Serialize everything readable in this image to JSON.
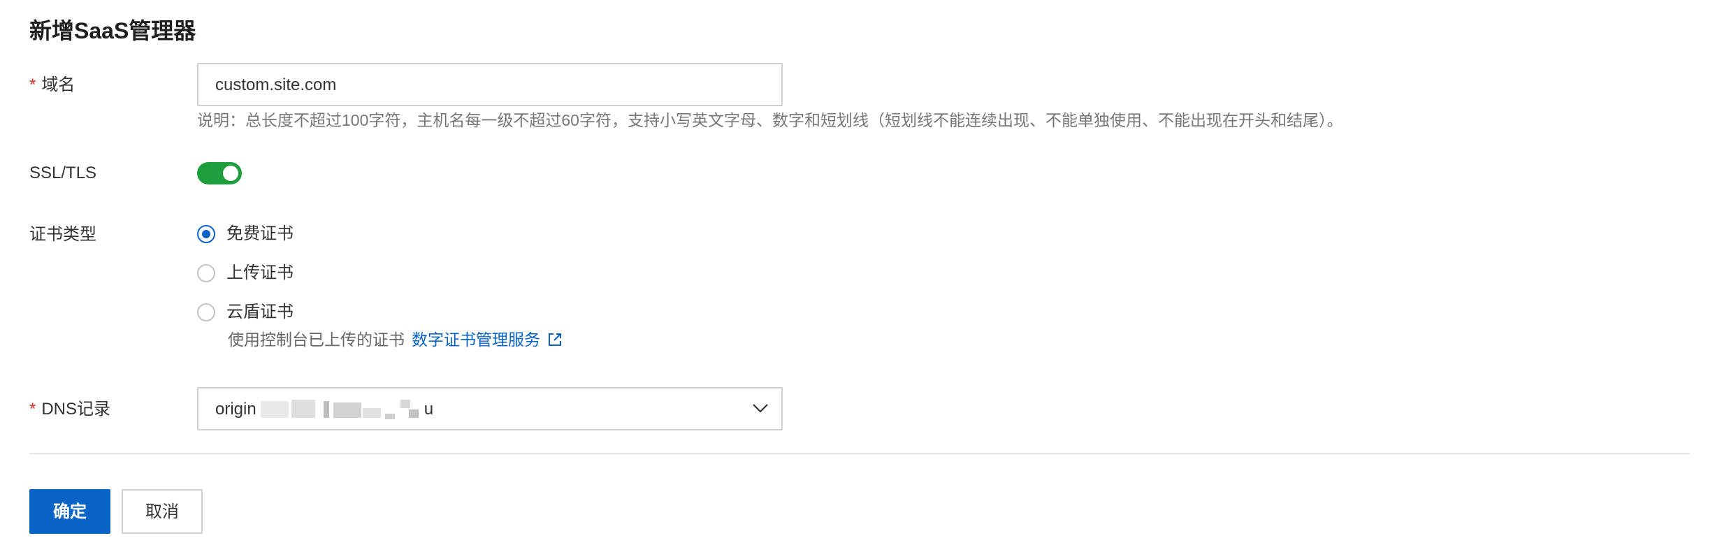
{
  "page": {
    "title": "新增SaaS管理器"
  },
  "domain_field": {
    "required_mark": "*",
    "label": "域名",
    "value": "custom.site.com",
    "hint": "说明：总长度不超过100字符，主机名每一级不超过60字符，支持小写英文字母、数字和短划线（短划线不能连续出现、不能单独使用、不能出现在开头和结尾）。"
  },
  "ssl_field": {
    "label": "SSL/TLS",
    "enabled": true
  },
  "cert_type": {
    "label": "证书类型",
    "options": [
      {
        "label": "免费证书",
        "checked": true
      },
      {
        "label": "上传证书",
        "checked": false
      },
      {
        "label": "云盾证书",
        "checked": false
      }
    ],
    "cloud_desc": "使用控制台已上传的证书",
    "cloud_link": "数字证书管理服务"
  },
  "dns_field": {
    "required_mark": "*",
    "label": "DNS记录",
    "value_prefix": "origin",
    "value_suffix": "u"
  },
  "actions": {
    "confirm": "确定",
    "cancel": "取消"
  },
  "colors": {
    "primary": "#0a64c8",
    "toggle_on": "#1e9e3c",
    "required": "#d93026"
  },
  "icons": {
    "external": "external-link-icon",
    "dropdown": "chevron-down-icon"
  }
}
